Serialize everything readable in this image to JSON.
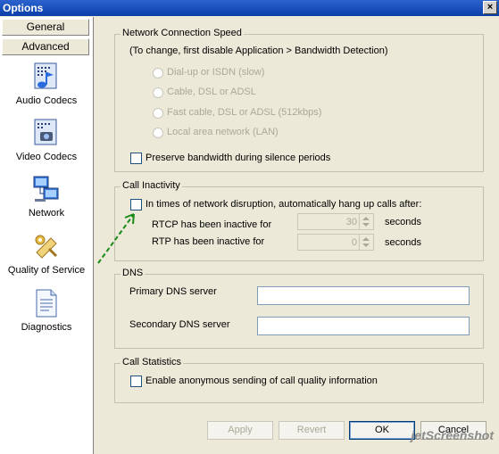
{
  "window": {
    "title": "Options",
    "close_glyph": "×"
  },
  "sidebar": {
    "tabs": [
      {
        "label": "General"
      },
      {
        "label": "Advanced"
      }
    ],
    "items": [
      {
        "label": "Audio Codecs",
        "icon": "audio-codecs-icon"
      },
      {
        "label": "Video Codecs",
        "icon": "video-codecs-icon"
      },
      {
        "label": "Network",
        "icon": "network-icon"
      },
      {
        "label": "Quality of Service",
        "icon": "quality-of-service-icon"
      },
      {
        "label": "Diagnostics",
        "icon": "diagnostics-icon"
      }
    ]
  },
  "network_speed": {
    "title": "Network Connection Speed",
    "hint": "(To change, first disable Application > Bandwidth Detection)",
    "options": [
      "Dial-up or ISDN (slow)",
      "Cable, DSL or ADSL",
      "Fast cable, DSL or ADSL (512kbps)",
      "Local area network (LAN)"
    ],
    "preserve_label": "Preserve bandwidth during silence periods"
  },
  "call_inactivity": {
    "title": "Call Inactivity",
    "hangup_label": "In times of network disruption, automatically hang up calls after:",
    "rtcp_label": "RTCP has been inactive for",
    "rtcp_value": "30",
    "rtp_label": "RTP has been inactive for",
    "rtp_value": "0",
    "unit": "seconds"
  },
  "dns": {
    "title": "DNS",
    "primary_label": "Primary DNS server",
    "primary_value": "",
    "secondary_label": "Secondary DNS server",
    "secondary_value": ""
  },
  "call_statistics": {
    "title": "Call Statistics",
    "anon_label": "Enable anonymous sending of call quality information"
  },
  "buttons": {
    "apply": "Apply",
    "revert": "Revert",
    "ok": "OK",
    "cancel": "Cancel"
  },
  "watermark": "jetScreenshot",
  "colors": {
    "annotation_arrow": "#1a8a1a",
    "titlebar": "#0a3fa8"
  }
}
